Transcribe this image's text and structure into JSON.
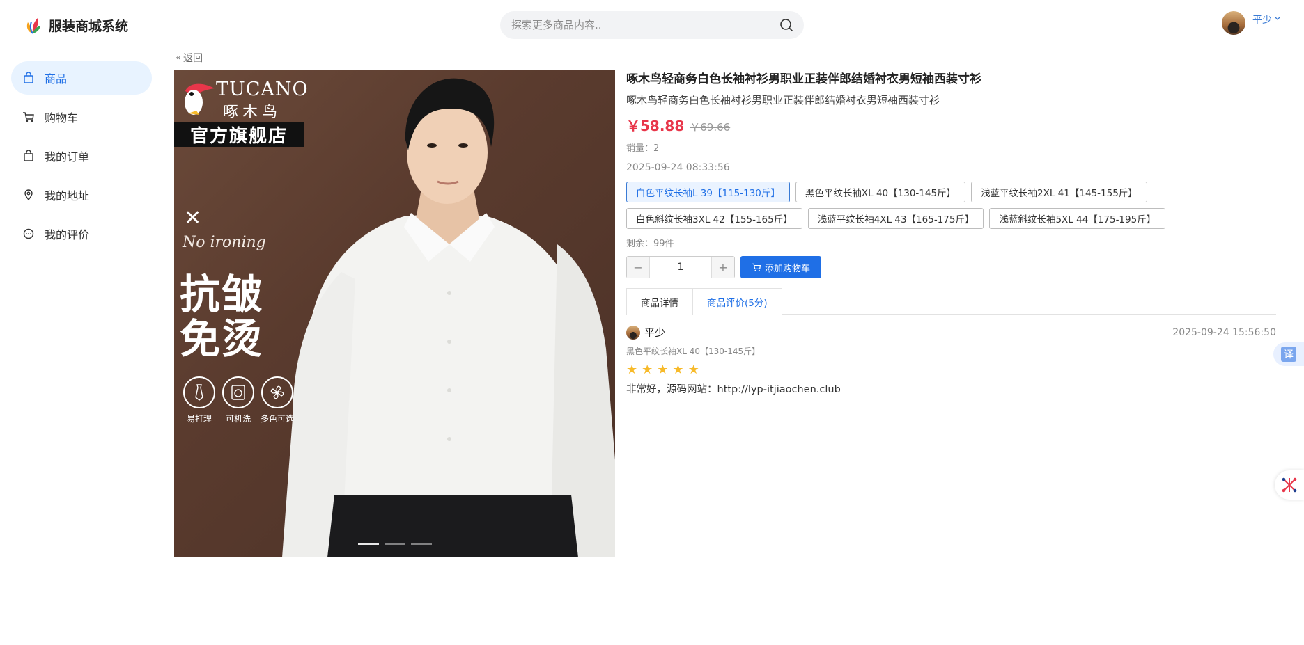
{
  "header": {
    "app_title": "服装商城系统",
    "search_placeholder": "探索更多商品内容..",
    "username": "平少",
    "logo_icon": "leaf-logo-icon"
  },
  "sidebar": {
    "items": [
      {
        "label": "商品",
        "icon": "shopping-bag-icon",
        "active": true
      },
      {
        "label": "购物车",
        "icon": "cart-icon",
        "active": false
      },
      {
        "label": "我的订单",
        "icon": "order-bag-icon",
        "active": false
      },
      {
        "label": "我的地址",
        "icon": "location-pin-icon",
        "active": false
      },
      {
        "label": "我的评价",
        "icon": "comment-icon",
        "active": false
      }
    ]
  },
  "back": {
    "label": "返回"
  },
  "product_image": {
    "brand_en": "TUCANO",
    "brand_cn": "啄木鸟",
    "flagship": "官方旗舰店",
    "no_ironing": "No ironing",
    "headline_line1": "抗皱",
    "headline_line2": "免烫",
    "features": [
      "易打理",
      "可机洗",
      "多色可选"
    ],
    "carousel_count": 3,
    "carousel_active": 0
  },
  "product": {
    "title": "啄木鸟轻商务白色长袖衬衫男职业正装伴郎结婚衬衣男短袖西装寸衫",
    "subtitle": "啄木鸟轻商务白色长袖衬衫男职业正装伴郎结婚衬衣男短袖西装寸衫",
    "price": "￥58.88",
    "price_old": "￥69.66",
    "sales": "销量：2",
    "date": "2025-09-24 08:33:56",
    "skus": [
      {
        "label": "白色平纹长袖L 39【115-130斤】",
        "active": true
      },
      {
        "label": "黑色平纹长袖XL 40【130-145斤】",
        "active": false
      },
      {
        "label": "浅蓝平纹长袖2XL 41【145-155斤】",
        "active": false
      },
      {
        "label": "白色斜纹长袖3XL 42【155-165斤】",
        "active": false
      },
      {
        "label": "浅蓝平纹长袖4XL 43【165-175斤】",
        "active": false
      },
      {
        "label": "浅蓝斜纹长袖5XL 44【175-195斤】",
        "active": false
      }
    ],
    "stock": "剩余：99件",
    "quantity": "1",
    "add_to_cart": "添加购物车"
  },
  "tabs": [
    {
      "label": "商品详情",
      "active": false
    },
    {
      "label": "商品评价(5分)",
      "active": true
    }
  ],
  "review": {
    "user": "平少",
    "time": "2025-09-24 15:56:50",
    "spec": "黑色平纹长袖XL 40【130-145斤】",
    "stars": 5,
    "text": "非常好，源码网站：http://lyp-itjiaochen.club"
  },
  "floats": {
    "translate_label": "译",
    "tool_icon": "network-tool-icon"
  },
  "colors": {
    "accent": "#1f6fe6",
    "price": "#e8364a",
    "star": "#f7ba2a",
    "active_bg": "#e8f3ff"
  }
}
